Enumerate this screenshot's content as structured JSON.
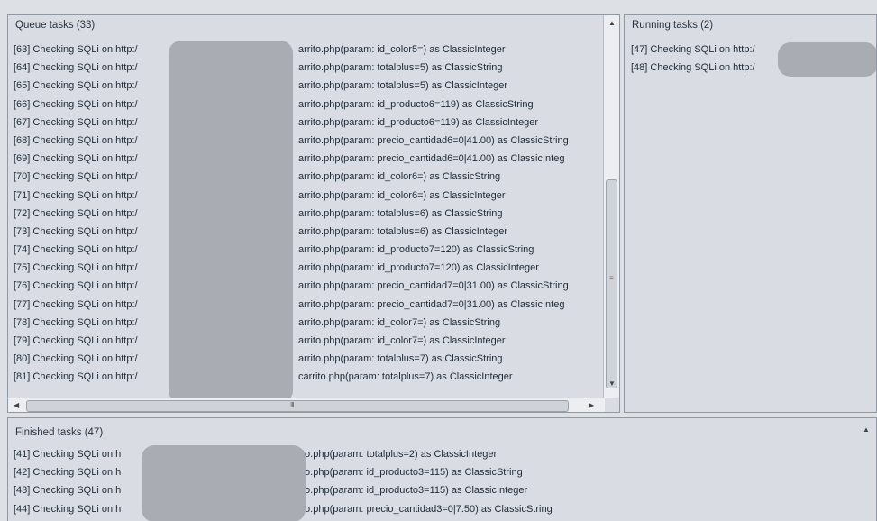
{
  "queue": {
    "title": "Queue tasks (33)",
    "rows": [
      {
        "id": "[63] Checking SQLi on http:/",
        "suffix": "arrito.php(param: id_color5=) as ClassicInteger"
      },
      {
        "id": "[64] Checking SQLi on http:/",
        "suffix": "arrito.php(param: totalplus=5) as ClassicString"
      },
      {
        "id": "[65] Checking SQLi on http:/",
        "suffix": "arrito.php(param: totalplus=5) as ClassicInteger"
      },
      {
        "id": "[66] Checking SQLi on http:/",
        "suffix": "arrito.php(param: id_producto6=119) as ClassicString"
      },
      {
        "id": "[67] Checking SQLi on http:/",
        "suffix": "arrito.php(param: id_producto6=119) as ClassicInteger"
      },
      {
        "id": "[68] Checking SQLi on http:/",
        "suffix": "arrito.php(param: precio_cantidad6=0|41.00) as ClassicString"
      },
      {
        "id": "[69] Checking SQLi on http:/",
        "suffix": "arrito.php(param: precio_cantidad6=0|41.00) as ClassicInteg"
      },
      {
        "id": "[70] Checking SQLi on http:/",
        "suffix": "arrito.php(param: id_color6=) as ClassicString"
      },
      {
        "id": "[71] Checking SQLi on http:/",
        "suffix": "arrito.php(param: id_color6=) as ClassicInteger"
      },
      {
        "id": "[72] Checking SQLi on http:/",
        "suffix": "arrito.php(param: totalplus=6) as ClassicString"
      },
      {
        "id": "[73] Checking SQLi on http:/",
        "suffix": "arrito.php(param: totalplus=6) as ClassicInteger"
      },
      {
        "id": "[74] Checking SQLi on http:/",
        "suffix": "arrito.php(param: id_producto7=120) as ClassicString"
      },
      {
        "id": "[75] Checking SQLi on http:/",
        "suffix": "arrito.php(param: id_producto7=120) as ClassicInteger"
      },
      {
        "id": "[76] Checking SQLi on http:/",
        "suffix": "arrito.php(param: precio_cantidad7=0|31.00) as ClassicString"
      },
      {
        "id": "[77] Checking SQLi on http:/",
        "suffix": "arrito.php(param: precio_cantidad7=0|31.00) as ClassicInteg"
      },
      {
        "id": "[78] Checking SQLi on http:/",
        "suffix": "arrito.php(param: id_color7=) as ClassicString"
      },
      {
        "id": "[79] Checking SQLi on http:/",
        "suffix": "arrito.php(param: id_color7=) as ClassicInteger"
      },
      {
        "id": "[80] Checking SQLi on http:/",
        "suffix": "arrito.php(param: totalplus=7) as ClassicString"
      },
      {
        "id": "[81] Checking SQLi on http:/",
        "suffix": "carrito.php(param: totalplus=7) as ClassicInteger"
      }
    ],
    "hscroll_grip": "III"
  },
  "running": {
    "title": "Running tasks (2)",
    "rows": [
      {
        "id": "[47] Checking SQLi on http:/"
      },
      {
        "id": "[48] Checking SQLi on http:/"
      }
    ]
  },
  "finished": {
    "title": "Finished tasks (47)",
    "rows": [
      {
        "id": "[41] Checking SQLi on h",
        "suffix": "to.php(param: totalplus=2) as ClassicInteger"
      },
      {
        "id": "[42] Checking SQLi on h",
        "suffix": "to.php(param: id_producto3=115) as ClassicString"
      },
      {
        "id": "[43] Checking SQLi on h",
        "suffix": "to.php(param: id_producto3=115) as ClassicInteger"
      },
      {
        "id": "[44] Checking SQLi on h",
        "suffix": "to.php(param: precio_cantidad3=0|7.50) as ClassicString"
      }
    ]
  },
  "icons": {
    "up": "scroll-up-arrow",
    "down": "scroll-down-arrow",
    "left": "scroll-left-arrow",
    "right": "scroll-right-arrow"
  }
}
